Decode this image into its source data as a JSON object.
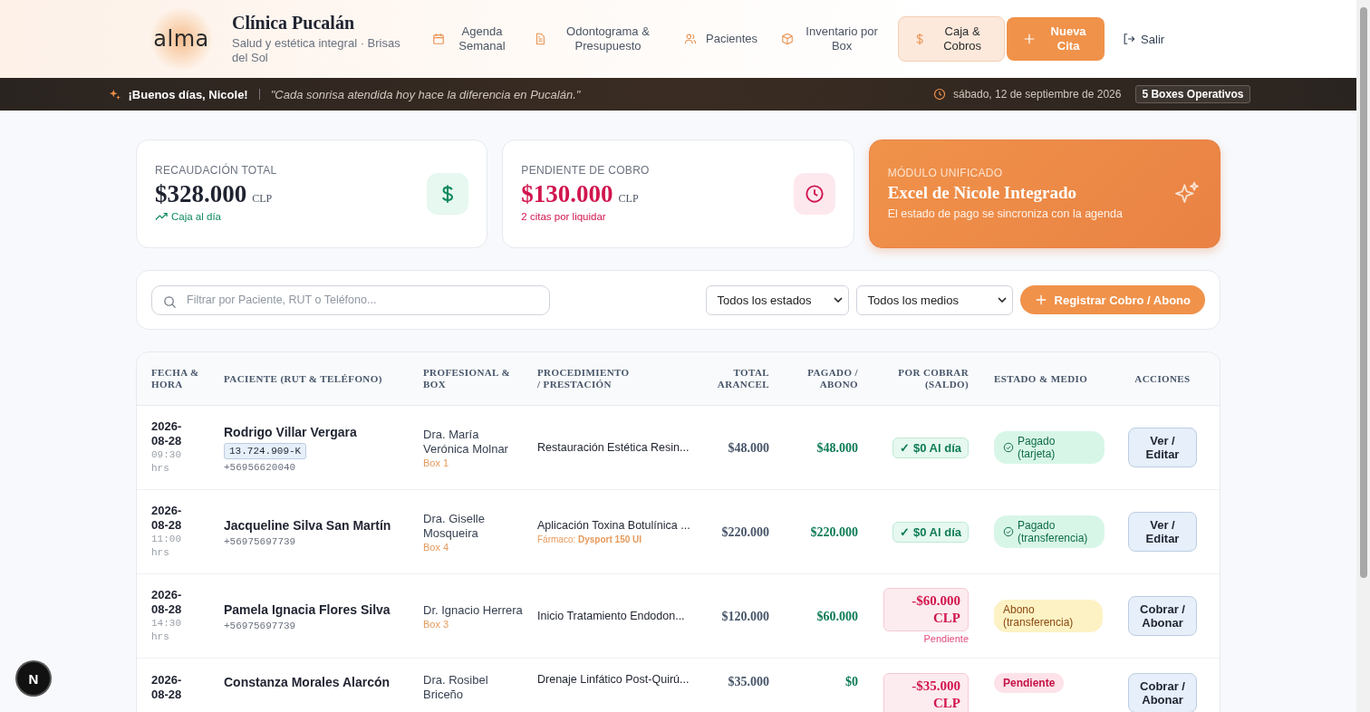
{
  "header": {
    "logo": "alma",
    "clinic_name": "Clínica Pucalán",
    "tagline": "Salud y estética integral · Brisas del Sol",
    "nav": [
      {
        "label": "Agenda Semanal",
        "selected": false
      },
      {
        "label": "Odontograma & Presupuesto",
        "selected": false
      },
      {
        "label": "Pacientes",
        "selected": false
      },
      {
        "label": "Inventario por Box",
        "selected": false
      },
      {
        "label": "Caja & Cobros",
        "selected": true
      }
    ],
    "new_button": "Nueva Cita",
    "logout": "Salir"
  },
  "banner": {
    "greeting": "¡Buenos días, Nicole!",
    "quote": "\"Cada sonrisa atendida hoy hace la diferencia en Pucalán.\"",
    "date": "sábado, 12 de septiembre de 2026",
    "badge": "5 Boxes Operativos"
  },
  "stats": [
    {
      "kind": "income",
      "label": "RECAUDACIÓN TOTAL",
      "value": "$328.000",
      "unit": "CLP",
      "note": "Caja al día"
    },
    {
      "kind": "pending",
      "label": "PENDIENTE DE COBRO",
      "value": "$130.000",
      "unit": "CLP",
      "note": "2 citas por liquidar"
    },
    {
      "kind": "feature",
      "label": "MÓDULO UNIFICADO",
      "value": "Excel de Nicole Integrado",
      "note": "El estado de pago se sincroniza con la agenda"
    }
  ],
  "filters": {
    "search_placeholder": "Filtrar por Paciente, RUT o Teléfono...",
    "status_select": "Todos los estados",
    "method_select": "Todos los medios",
    "register_button": "Registrar Cobro / Abono"
  },
  "table": {
    "columns": [
      "FECHA & HORA",
      "PACIENTE (RUT & TELÉFONO)",
      "PROFESIONAL & BOX",
      "PROCEDIMIENTO / PRESTACIÓN",
      "TOTAL ARANCEL",
      "PAGADO / ABONO",
      "POR COBRAR (SALDO)",
      "ESTADO & MEDIO",
      "ACCIONES"
    ],
    "rows": [
      {
        "date": "2026-08-28",
        "time": "09:30 hrs",
        "patient": "Rodrigo Villar Vergara",
        "rut": "13.724.909-K",
        "phone": "+56956620040",
        "professional": "Dra. María Verónica Molnar",
        "box": "Box 1",
        "procedure": "Restauración Estética Resin...",
        "total": "$48.000",
        "paid": "$48.000",
        "balance": {
          "kind": "clear",
          "text": "✓ $0 Al día"
        },
        "status": {
          "kind": "paid",
          "text": "Pagado (tarjeta)"
        },
        "action": "Ver / Editar"
      },
      {
        "date": "2026-08-28",
        "time": "11:00 hrs",
        "patient": "Jacqueline Silva San Martín",
        "phone": "+56975697739",
        "professional": "Dra. Giselle Mosqueira",
        "box": "Box 4",
        "procedure": "Aplicación Toxina Botulínica ...",
        "drug_label": "Fármaco:",
        "drug": "Dysport 150 UI",
        "total": "$220.000",
        "paid": "$220.000",
        "balance": {
          "kind": "clear",
          "text": "✓ $0 Al día"
        },
        "status": {
          "kind": "paid",
          "text": "Pagado (transferencia)"
        },
        "action": "Ver / Editar"
      },
      {
        "date": "2026-08-28",
        "time": "14:30 hrs",
        "patient": "Pamela Ignacia Flores Silva",
        "phone": "+56975697739",
        "professional": "Dr. Ignacio Herrera",
        "box": "Box 3",
        "procedure": "Inicio Tratamiento Endodon...",
        "total": "$120.000",
        "paid": "$60.000",
        "balance": {
          "kind": "due",
          "text": "-$60.000 CLP",
          "note": "Pendiente"
        },
        "status": {
          "kind": "partial",
          "text": "Abono (transferencia)"
        },
        "action": "Cobrar / Abonar"
      },
      {
        "date": "2026-08-28",
        "patient": "Constanza Morales Alarcón",
        "professional": "Dra. Rosibel Briceño",
        "procedure": "Drenaje Linfático Post-Quirú...",
        "total": "$35.000",
        "paid": "$0",
        "balance": {
          "kind": "due",
          "text": "-$35.000 CLP"
        },
        "status": {
          "kind": "pending",
          "text": "Pendiente"
        },
        "action": "Cobrar / Abonar"
      }
    ]
  },
  "dev_badge": "N"
}
